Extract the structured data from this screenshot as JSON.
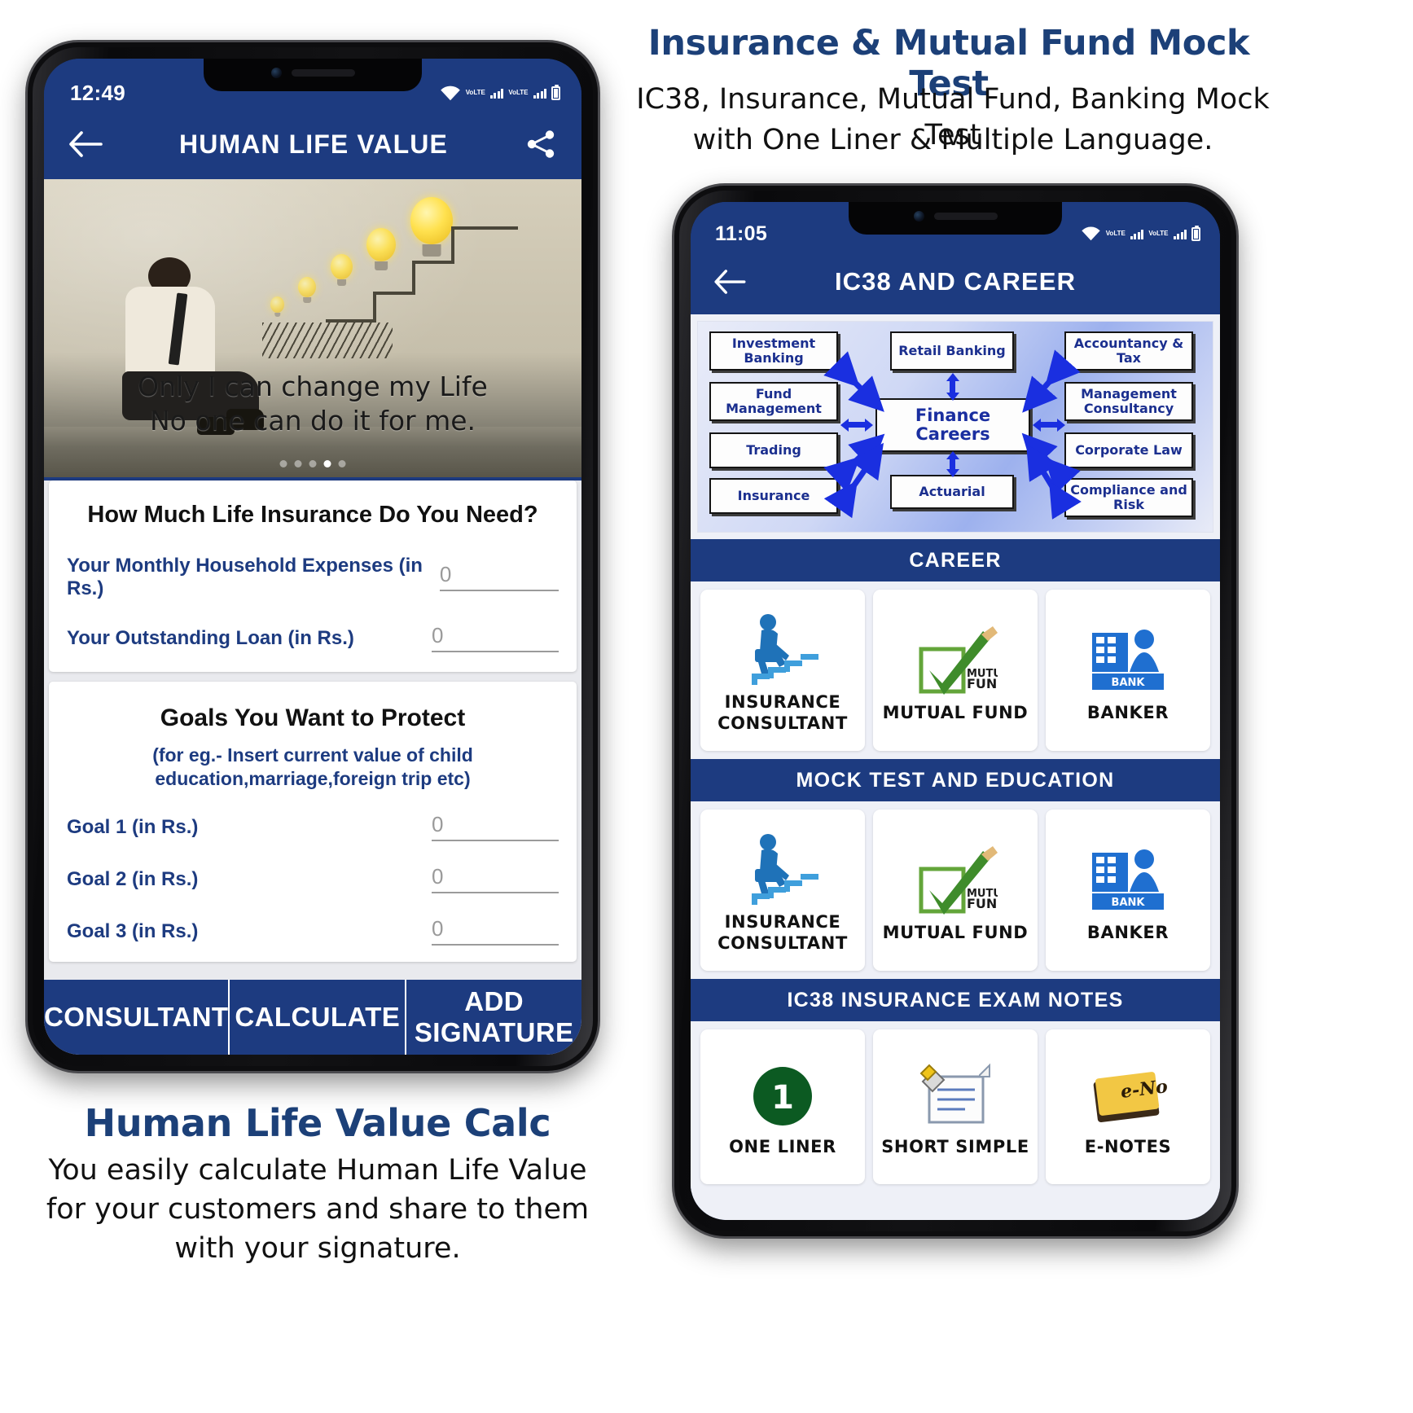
{
  "promo": {
    "right_title": "Insurance & Mutual Fund Mock Test",
    "right_sub_line1": "IC38, Insurance, Mutual Fund, Banking Mock Test",
    "right_sub_line2": "with One Liner & Multiple Language.",
    "left_title": "Human Life Value Calc",
    "left_sub_line1": "You easily calculate Human Life Value",
    "left_sub_line2": "for your customers and share to them",
    "left_sub_line3": "with your signature."
  },
  "colors": {
    "brand_blue": "#1d3b80",
    "promo_title_blue": "#1c4078",
    "label_blue": "#1d3b80",
    "diagram_arrow": "#1a2fe0",
    "tile_bg": "#ffffff",
    "page_bg": "#eef0f7"
  },
  "phone1": {
    "status": {
      "time": "12:49",
      "wifi": "wifi-icon",
      "volte": "VoLTE",
      "signal": "signal-bars-icon",
      "battery": "battery-icon"
    },
    "appbar": {
      "back": "back-arrow-icon",
      "title": "HUMAN LIFE VALUE",
      "share": "share-icon"
    },
    "hero": {
      "caption_line1": "Only I can change my Life",
      "caption_line2": "No one can do it for me.",
      "dots": [
        "inactive",
        "inactive",
        "inactive",
        "active",
        "inactive"
      ]
    },
    "section1": {
      "title": "How Much Life Insurance Do You Need?",
      "fields": [
        {
          "label": "Your Monthly Household Expenses (in Rs.)",
          "value": "0",
          "placeholder": "0"
        },
        {
          "label": "Your Outstanding Loan (in Rs.)",
          "value": "0",
          "placeholder": "0"
        }
      ]
    },
    "section2": {
      "title": "Goals You Want to Protect",
      "subtitle_line1": "(for eg.- Insert current value of child",
      "subtitle_line2": "education,marriage,foreign trip etc)",
      "fields": [
        {
          "label": "Goal 1 (in Rs.)",
          "value": "0",
          "placeholder": "0"
        },
        {
          "label": "Goal 2 (in Rs.)",
          "value": "0",
          "placeholder": "0"
        },
        {
          "label": "Goal 3 (in Rs.)",
          "value": "0",
          "placeholder": "0"
        }
      ]
    },
    "buttons": [
      {
        "label": "CONSULTANT"
      },
      {
        "label": "CALCULATE"
      },
      {
        "label": "ADD SIGNATURE"
      }
    ]
  },
  "phone2": {
    "status": {
      "time": "11:05",
      "wifi": "wifi-icon",
      "volte": "VoLTE",
      "signal": "signal-bars-icon",
      "battery": "battery-icon"
    },
    "appbar": {
      "back": "back-arrow-icon",
      "title": "IC38 AND CAREER"
    },
    "diagram": {
      "center": "Finance Careers",
      "left": [
        "Investment Banking",
        "Fund Management",
        "Trading",
        "Insurance"
      ],
      "top": "Retail Banking",
      "bottom": "Actuarial",
      "right": [
        "Accountancy & Tax",
        "Management Consultancy",
        "Corporate Law",
        "Compliance and Risk"
      ]
    },
    "sections": [
      {
        "header": "CAREER",
        "tiles": [
          {
            "label": "INSURANCE CONSULTANT",
            "icon": "insurance-consultant-icon"
          },
          {
            "label": "MUTUAL FUND",
            "icon": "mutual-fund-icon"
          },
          {
            "label": "BANKER",
            "icon": "banker-icon"
          }
        ]
      },
      {
        "header": "MOCK TEST AND EDUCATION",
        "tiles": [
          {
            "label": "INSURANCE CONSULTANT",
            "icon": "insurance-consultant-icon"
          },
          {
            "label": "MUTUAL FUND",
            "icon": "mutual-fund-icon"
          },
          {
            "label": "BANKER",
            "icon": "banker-icon"
          }
        ]
      },
      {
        "header": "IC38 INSURANCE EXAM NOTES",
        "tiles": [
          {
            "label": "ONE LINER",
            "icon": "one-liner-badge-icon"
          },
          {
            "label": "SHORT SIMPLE",
            "icon": "note-pencil-icon"
          },
          {
            "label": "E-NOTES",
            "icon": "e-notes-icon"
          }
        ]
      }
    ],
    "badge_number": "1",
    "bank_label": "BANK",
    "mutual_fund_mark_line1": "MUTUAL",
    "mutual_fund_mark_line2": "FUND",
    "enotes_mark": "e-Notes"
  }
}
